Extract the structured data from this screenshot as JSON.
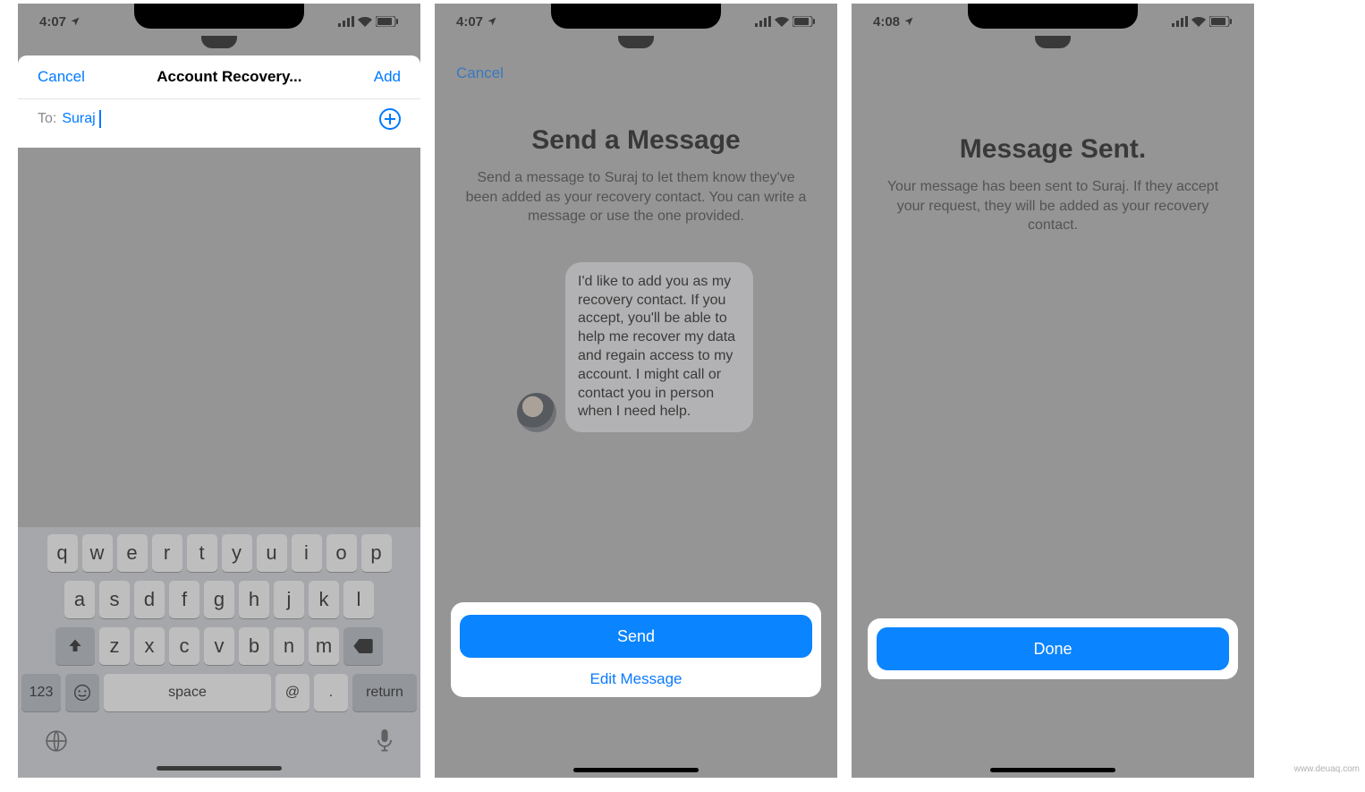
{
  "status": {
    "time1": "4:07",
    "time2": "4:07",
    "time3": "4:08"
  },
  "phone1": {
    "cancel": "Cancel",
    "title": "Account Recovery...",
    "add": "Add",
    "to_label": "To:",
    "to_value": "Suraj"
  },
  "keyboard": {
    "row1": [
      "q",
      "w",
      "e",
      "r",
      "t",
      "y",
      "u",
      "i",
      "o",
      "p"
    ],
    "row2": [
      "a",
      "s",
      "d",
      "f",
      "g",
      "h",
      "j",
      "k",
      "l"
    ],
    "row3": [
      "z",
      "x",
      "c",
      "v",
      "b",
      "n",
      "m"
    ],
    "num": "123",
    "space": "space",
    "at": "@",
    "dot": ".",
    "return": "return"
  },
  "phone2": {
    "cancel": "Cancel",
    "title": "Send a Message",
    "subtitle": "Send a message to Suraj to let them know they've been added as your recovery contact. You can write a message or use the one provided.",
    "bubble": "I'd like to add you as my recovery contact. If you accept, you'll be able to help me recover my data and regain access to my account. I might call or contact you in person when I need help.",
    "send": "Send",
    "edit": "Edit Message"
  },
  "phone3": {
    "title": "Message Sent.",
    "subtitle": "Your message has been sent to Suraj. If they accept your request, they will be added as your recovery contact.",
    "done": "Done"
  },
  "watermark": "www.deuaq.com"
}
